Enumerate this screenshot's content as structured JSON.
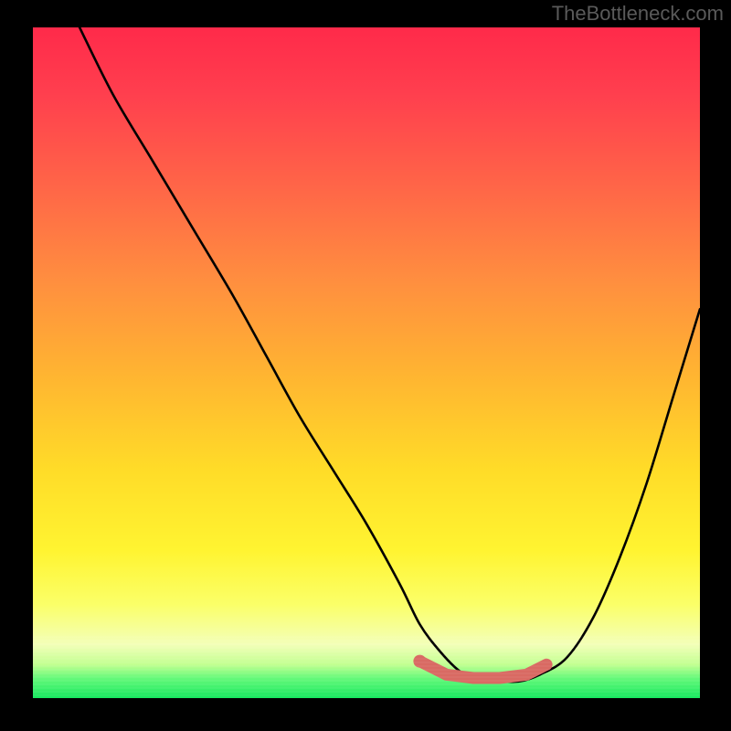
{
  "watermark": "TheBottleneck.com",
  "chart_data": {
    "type": "line",
    "title": "",
    "xlabel": "",
    "ylabel": "",
    "xlim": [
      0,
      100
    ],
    "ylim": [
      0,
      100
    ],
    "series": [
      {
        "name": "bottleneck-curve",
        "x": [
          7,
          12,
          18,
          24,
          30,
          35,
          40,
          45,
          50,
          55,
          58,
          61,
          64,
          67,
          70,
          73,
          76,
          80,
          84,
          88,
          92,
          96,
          100
        ],
        "values": [
          100,
          90,
          80,
          70,
          60,
          51,
          42,
          34,
          26,
          17,
          11,
          7,
          4,
          2.5,
          2.5,
          2.5,
          3.5,
          6,
          12,
          21,
          32,
          45,
          58
        ]
      },
      {
        "name": "optimal-zone",
        "x": [
          58,
          62,
          66,
          70,
          74,
          77
        ],
        "values": [
          5.5,
          3.5,
          3,
          3,
          3.5,
          5
        ]
      }
    ],
    "gradient_stops": [
      {
        "pos": 0,
        "color": "#ff2a4a"
      },
      {
        "pos": 25,
        "color": "#ff8f3f"
      },
      {
        "pos": 66,
        "color": "#ffdc28"
      },
      {
        "pos": 92,
        "color": "#f3ffb8"
      },
      {
        "pos": 100,
        "color": "#16e85f"
      }
    ]
  }
}
